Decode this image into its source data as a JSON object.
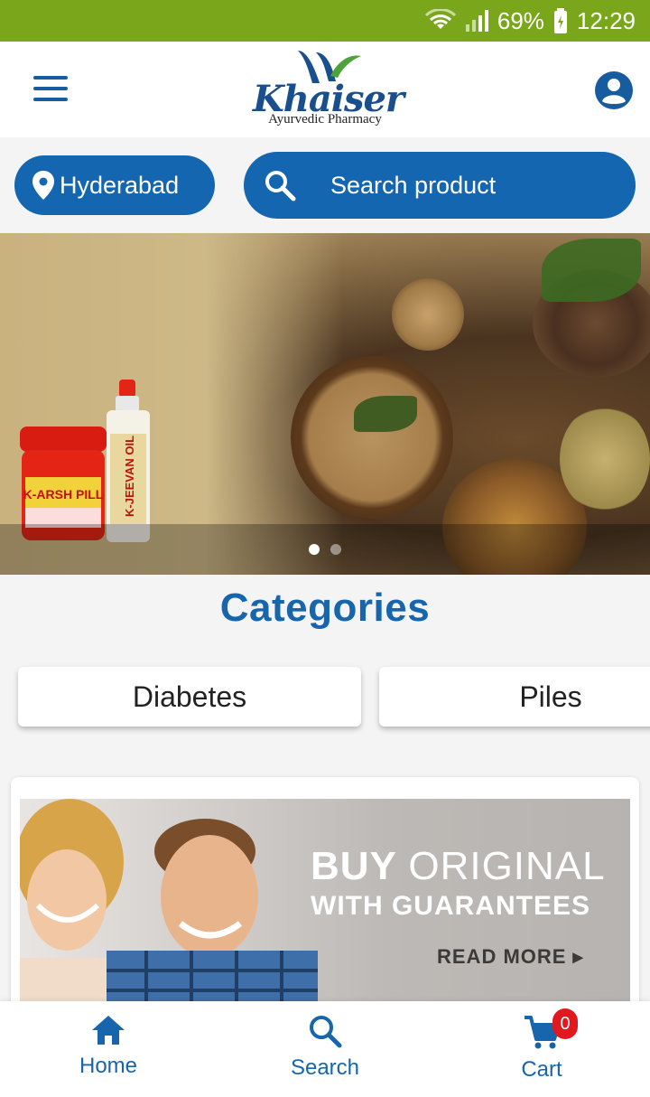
{
  "status_bar": {
    "battery": "69%",
    "time": "12:29",
    "background_color": "#7aa61b"
  },
  "header": {
    "brand_name": "Khaiser",
    "brand_tagline": "Ayurvedic Pharmacy",
    "menu_icon": "hamburger-icon",
    "profile_icon": "account-circle-icon"
  },
  "location": {
    "label": "Hyderabad",
    "icon": "location-pin-icon"
  },
  "search": {
    "placeholder": "Search product",
    "icon": "search-icon"
  },
  "banner": {
    "products": [
      "K-ARSH PILL",
      "K-JEEVAN OIL"
    ],
    "slide_count": 2,
    "active_slide": 1
  },
  "categories": {
    "title": "Categories",
    "items": [
      "Diabetes",
      "Piles"
    ]
  },
  "promo": {
    "line1_bold": "BUY",
    "line1_light": "ORIGINAL",
    "line2": "WITH GUARANTEES",
    "cta": "READ MORE ▸"
  },
  "bottom_nav": {
    "items": [
      {
        "label": "Home",
        "icon": "home-icon"
      },
      {
        "label": "Search",
        "icon": "search-icon"
      },
      {
        "label": "Cart",
        "icon": "cart-icon",
        "badge": "0"
      }
    ]
  },
  "colors": {
    "primary": "#1566b0",
    "title": "#1766ad",
    "badge": "#e0191e"
  }
}
